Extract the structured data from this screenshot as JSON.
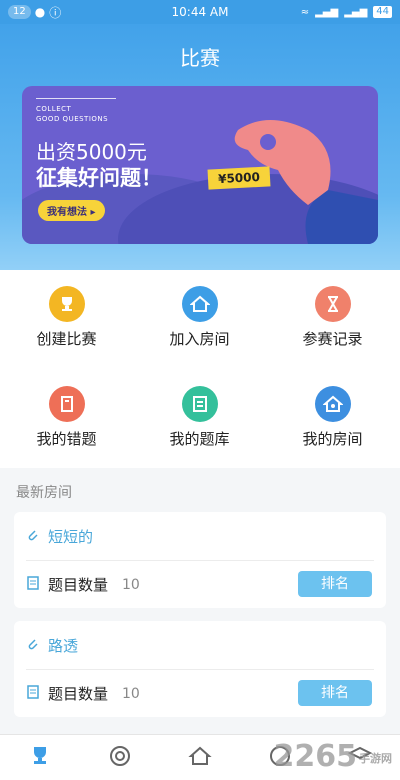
{
  "status_bar": {
    "left_badge": "12",
    "time": "10:44 AM",
    "battery": "44"
  },
  "header": {
    "title": "比赛"
  },
  "banner": {
    "collect_line1": "COLLECT",
    "collect_line2": "GOOD QUESTIONS",
    "headline1": "出资5000元",
    "headline2": "征集好问题！",
    "button_label": "我有想法 ▸",
    "money_tag": "¥5000"
  },
  "menu": {
    "items": [
      {
        "label": "创建比赛",
        "icon": "trophy-icon",
        "color": "#f3b623"
      },
      {
        "label": "加入房间",
        "icon": "home-icon",
        "color": "#3d9ee6"
      },
      {
        "label": "参赛记录",
        "icon": "hourglass-icon",
        "color": "#f0816b"
      },
      {
        "label": "我的错题",
        "icon": "book-icon",
        "color": "#ee6f57"
      },
      {
        "label": "我的题库",
        "icon": "list-icon",
        "color": "#34c09b"
      },
      {
        "label": "我的房间",
        "icon": "home-key-icon",
        "color": "#3d8fe0"
      }
    ]
  },
  "section": {
    "title": "最新房间"
  },
  "rooms": [
    {
      "name": "短短的",
      "count_label": "题目数量",
      "count": "10",
      "rank_label": "排名"
    },
    {
      "name": "路透",
      "count_label": "题目数量",
      "count": "10",
      "rank_label": "排名"
    }
  ],
  "bottom_nav": [
    "trophy-icon",
    "target-icon",
    "home-heart-icon",
    "compass-icon",
    "graduation-icon"
  ],
  "watermark": {
    "main": "2265",
    "sub": "手游网"
  }
}
